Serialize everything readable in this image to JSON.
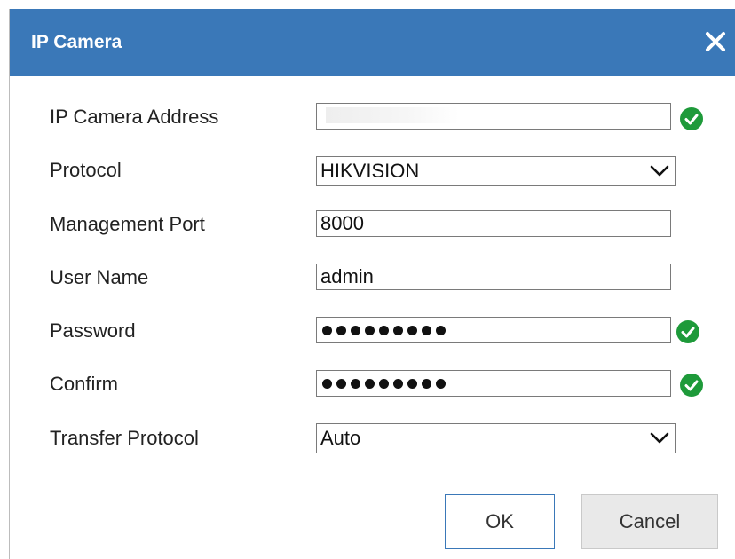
{
  "dialog": {
    "title": "IP Camera",
    "close_icon": "close-icon",
    "title_bar_color": "#3a78b8"
  },
  "form": {
    "ip_address": {
      "label": "IP Camera Address",
      "value": ""
    },
    "protocol": {
      "label": "Protocol",
      "value": "HIKVISION"
    },
    "management_port": {
      "label": "Management Port",
      "value": "8000"
    },
    "user_name": {
      "label": "User Name",
      "value": "admin"
    },
    "password": {
      "label": "Password",
      "masked_length": 9
    },
    "confirm": {
      "label": "Confirm",
      "masked_length": 9
    },
    "transfer_protocol": {
      "label": "Transfer Protocol",
      "value": "Auto"
    }
  },
  "validation": {
    "icon": "check-circle-icon",
    "color": "#1e9a3a"
  },
  "buttons": {
    "ok_label": "OK",
    "cancel_label": "Cancel"
  }
}
